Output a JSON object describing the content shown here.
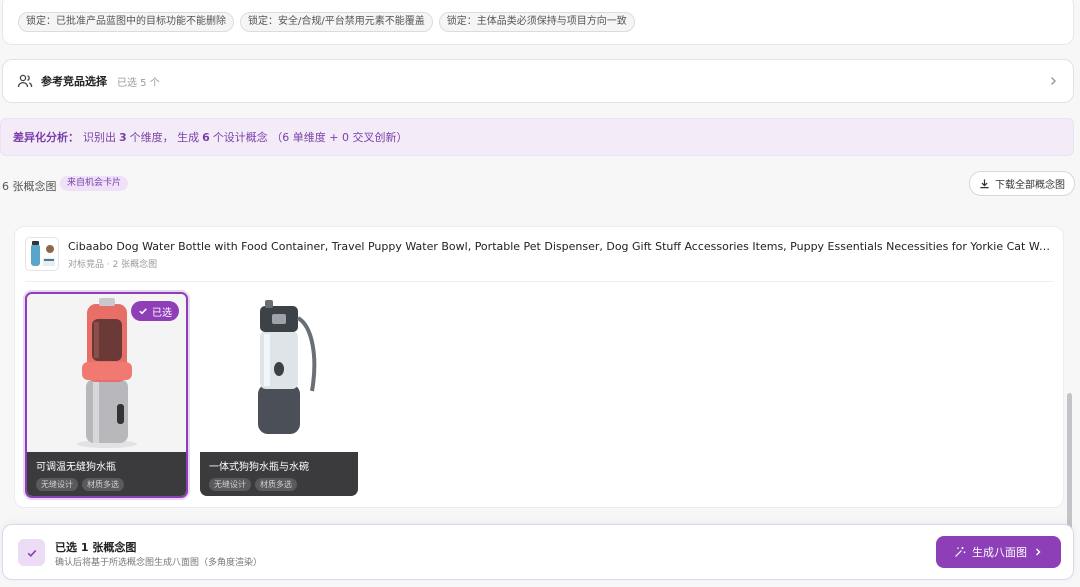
{
  "locks": [
    "锁定：已批准产品蓝图中的目标功能不能删除",
    "锁定：安全/合规/平台禁用元素不能覆盖",
    "锁定：主体品类必须保持与项目方向一致"
  ],
  "competitor": {
    "title": "参考竞品选择",
    "selected_text": "已选 5 个"
  },
  "differentiation": {
    "lead": "差异化分析：",
    "t1": "识别出",
    "dims": "3",
    "t2": "个维度，  生成",
    "concepts": "6",
    "t3": "个设计概念  （6 单维度 + 0 交叉创新）"
  },
  "concepts_header": {
    "count_text": "6 张概念图",
    "source_badge": "来自机会卡片",
    "download_label": "下载全部概念图"
  },
  "product": {
    "title": "Cibaabo Dog Water Bottle with Food Container, Travel Puppy Water Bowl, Portable Pet Dispenser, Dog Gift Stuff Accessories Items, Puppy Essentials Necessities for Yorkie Cat Walking and Travel",
    "meta": "对标竞品 · 2 张概念图",
    "concepts": [
      {
        "title": "可调温无缝狗水瓶",
        "tags": [
          "无缝设计",
          "材质多选"
        ],
        "selected": true
      },
      {
        "title": "一体式狗狗水瓶与水碗",
        "tags": [
          "无缝设计",
          "材质多选"
        ],
        "selected": false
      }
    ],
    "selected_badge": "已选"
  },
  "action_bar": {
    "title": "已选 1 张概念图",
    "subtitle": "确认后将基于所选概念图生成八面图（多角度渲染）",
    "button_label": "生成八面图"
  },
  "colors": {
    "accent": "#8c3fb6",
    "accent_light": "#f3ecf8"
  }
}
